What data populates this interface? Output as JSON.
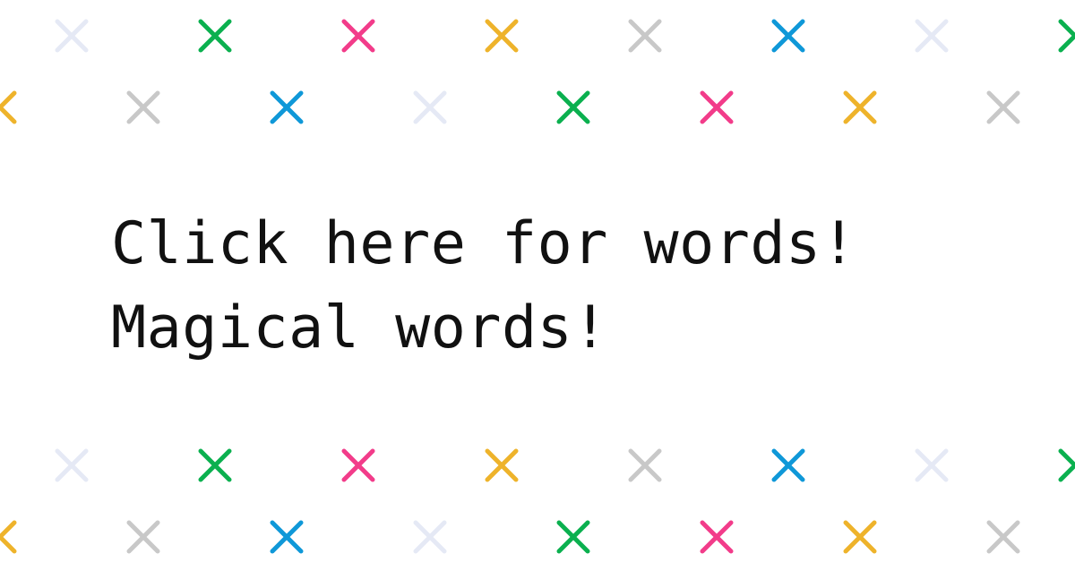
{
  "headline": {
    "line1": "Click here for words!",
    "line2": "Magical words!"
  },
  "pattern": {
    "icon": "cross-icon",
    "colors": {
      "faint": "#e5e9f5",
      "green": "#0bb04f",
      "pink": "#f23c8a",
      "yellow": "#eeb32b",
      "gray": "#c8c8c8",
      "blue": "#0f98d8"
    },
    "row_a_colors": [
      "faint",
      "green",
      "pink",
      "yellow",
      "gray",
      "blue",
      "faint",
      "green"
    ],
    "row_b_colors": [
      "yellow",
      "gray",
      "blue",
      "faint",
      "green",
      "pink",
      "yellow",
      "gray"
    ]
  }
}
